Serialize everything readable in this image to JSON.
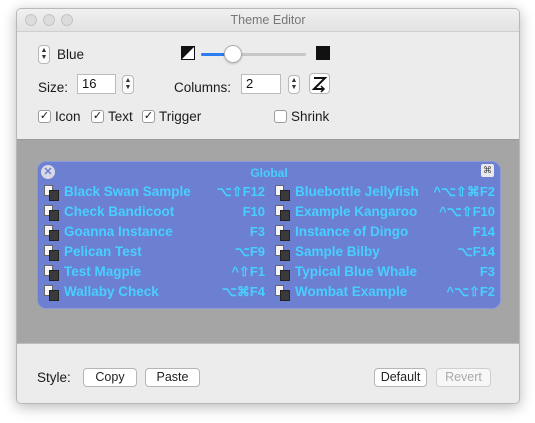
{
  "window": {
    "title": "Theme Editor"
  },
  "theme": {
    "name": "Blue"
  },
  "size": {
    "label": "Size:",
    "value": "16"
  },
  "columns": {
    "label": "Columns:",
    "value": "2"
  },
  "slider": {
    "value_fraction": 0.3
  },
  "options": {
    "icon": {
      "label": "Icon",
      "checked": true
    },
    "text": {
      "label": "Text",
      "checked": true
    },
    "trigger": {
      "label": "Trigger",
      "checked": true
    },
    "shrink": {
      "label": "Shrink",
      "checked": false
    }
  },
  "preview": {
    "menu_title": "Global",
    "accent_color": "#47d0ff",
    "menu_bg_color": "#6c7fd0",
    "left_items": [
      {
        "name": "Black Swan Sample",
        "shortcut": "⌥⇧F12"
      },
      {
        "name": "Check Bandicoot",
        "shortcut": "F10"
      },
      {
        "name": "Goanna Instance",
        "shortcut": "F3"
      },
      {
        "name": "Pelican Test",
        "shortcut": "⌥F9"
      },
      {
        "name": "Test Magpie",
        "shortcut": "^⇧F1"
      },
      {
        "name": "Wallaby Check",
        "shortcut": "⌥⌘F4"
      }
    ],
    "right_items": [
      {
        "name": "Bluebottle Jellyfish",
        "shortcut": "^⌥⇧⌘F2"
      },
      {
        "name": "Example Kangaroo",
        "shortcut": "^⌥⇧F10"
      },
      {
        "name": "Instance of Dingo",
        "shortcut": "F14"
      },
      {
        "name": "Sample Bilby",
        "shortcut": "⌥F14"
      },
      {
        "name": "Typical Blue Whale",
        "shortcut": "F3"
      },
      {
        "name": "Wombat Example",
        "shortcut": "^⌥⇧F2"
      }
    ]
  },
  "bottom": {
    "style_label": "Style:",
    "copy": "Copy",
    "paste": "Paste",
    "default": "Default",
    "revert": "Revert"
  }
}
